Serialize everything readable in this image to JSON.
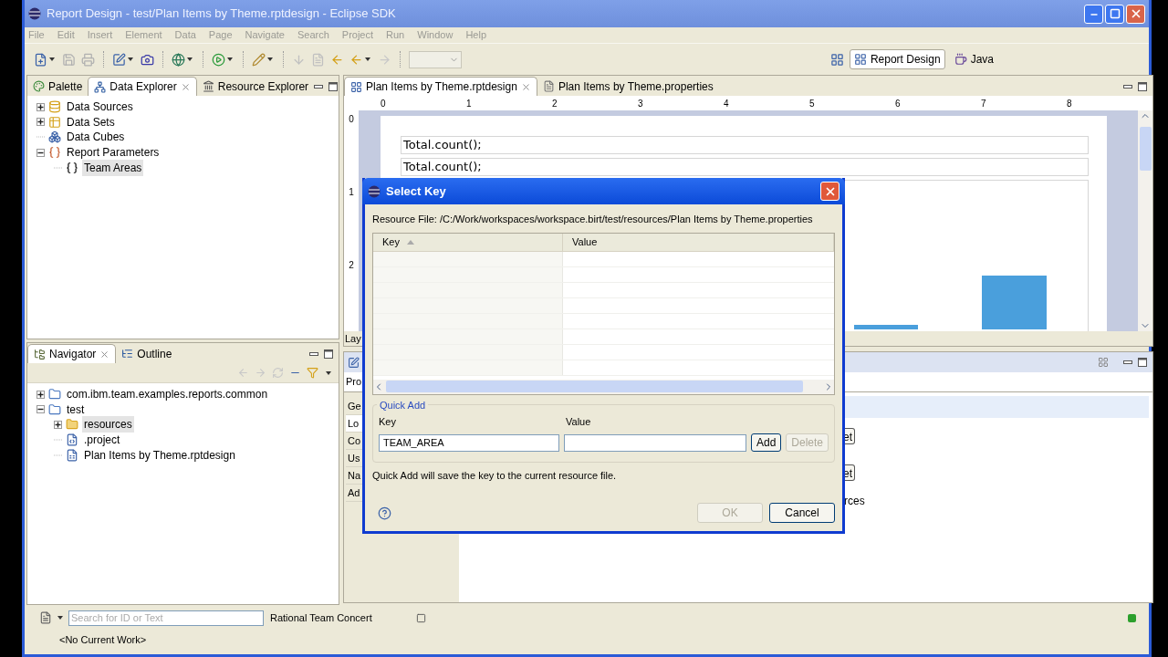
{
  "window": {
    "title": "Report Design - test/Plan Items by Theme.rptdesign - Eclipse SDK"
  },
  "menu": [
    "File",
    "Edit",
    "Insert",
    "Element",
    "Data",
    "Page",
    "Navigate",
    "Search",
    "Project",
    "Run",
    "Window",
    "Help"
  ],
  "perspectives": [
    {
      "label": "Report Design",
      "selected": true
    },
    {
      "label": "Java",
      "selected": false
    }
  ],
  "data_view": {
    "tabs": [
      {
        "label": "Palette",
        "selected": false,
        "kind": "palette"
      },
      {
        "label": "Data Explorer",
        "selected": true,
        "kind": "data"
      },
      {
        "label": "Resource Explorer",
        "selected": false,
        "kind": "resource"
      }
    ],
    "tree": [
      {
        "label": "Data Sources",
        "kind": "data-source",
        "expandable": true,
        "expanded": false,
        "selected": false
      },
      {
        "label": "Data Sets",
        "kind": "data-set",
        "expandable": true,
        "expanded": false,
        "selected": false
      },
      {
        "label": "Data Cubes",
        "kind": "data-cube",
        "expandable": false,
        "selected": false
      },
      {
        "label": "Report Parameters",
        "kind": "parameters",
        "expandable": true,
        "expanded": true,
        "selected": false,
        "children": [
          {
            "label": "Team Areas",
            "kind": "parameter",
            "expandable": false,
            "selected": true
          }
        ]
      }
    ]
  },
  "navigator_view": {
    "tabs": [
      {
        "label": "Navigator",
        "selected": true,
        "kind": "navigator"
      },
      {
        "label": "Outline",
        "selected": false,
        "kind": "outline"
      }
    ],
    "tree": [
      {
        "label": "com.ibm.team.examples.reports.common",
        "kind": "project",
        "expandable": true,
        "expanded": false,
        "selected": false
      },
      {
        "label": "test",
        "kind": "project",
        "expandable": true,
        "expanded": true,
        "selected": false,
        "children": [
          {
            "label": "resources",
            "kind": "folder",
            "expandable": true,
            "expanded": false,
            "selected": true
          },
          {
            "label": ".project",
            "kind": "xml-file",
            "expandable": false,
            "selected": false
          },
          {
            "label": "Plan Items by Theme.rptdesign",
            "kind": "report-file",
            "expandable": false,
            "selected": false
          }
        ]
      }
    ]
  },
  "editor": {
    "tabs": [
      {
        "label": "Plan Items by Theme.rptdesign",
        "selected": true,
        "kind": "report"
      },
      {
        "label": "Plan Items by Theme.properties",
        "selected": false,
        "kind": "text"
      }
    ],
    "ruler": [
      "0",
      "1",
      "2",
      "3",
      "4",
      "5",
      "6",
      "7",
      "8"
    ],
    "vertical_ruler": [
      "0",
      "1",
      "2"
    ],
    "rows": [
      "Total.count();",
      "Total.count();"
    ],
    "bottom_tab": "Lay"
  },
  "properties_view": {
    "tab": "Pro",
    "sections": [
      {
        "label": "Ge",
        "selected": false
      },
      {
        "label": "Lo",
        "selected": true
      },
      {
        "label": "Co",
        "selected": false
      },
      {
        "label": "Us",
        "selected": false
      },
      {
        "label": "Na",
        "selected": false
      },
      {
        "label": "Ad",
        "selected": false
      }
    ],
    "buttons": [
      "et",
      "et"
    ],
    "text": "rces"
  },
  "dialog": {
    "title": "Select Key",
    "resource_file": "Resource File: /C:/Work/workspaces/workspace.birt/test/resources/Plan Items by Theme.properties",
    "columns": [
      {
        "label": "Key",
        "sorted": true
      },
      {
        "label": "Value",
        "sorted": false
      }
    ],
    "quick_add": {
      "legend": "Quick Add",
      "key_label": "Key",
      "key_value": "TEAM_AREA",
      "value_label": "Value",
      "buttons": [
        {
          "label": "Add",
          "disabled": false
        },
        {
          "label": "Delete",
          "disabled": true
        }
      ]
    },
    "note": "Quick Add will save the key to the current resource file.",
    "buttons": [
      {
        "label": "OK",
        "disabled": true
      },
      {
        "label": "Cancel",
        "disabled": false
      }
    ]
  },
  "status_bar": {
    "search": {
      "placeholder": "Search for ID or Text"
    },
    "label": "Rational Team Concert",
    "work": "<No Current Work>"
  }
}
